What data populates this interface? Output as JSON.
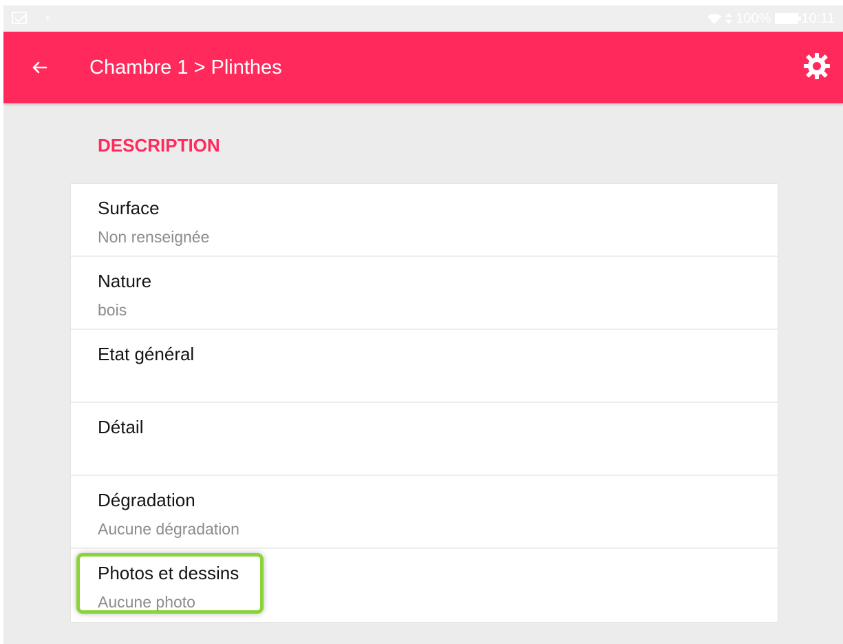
{
  "status_bar": {
    "battery": "100%",
    "time": "10:11"
  },
  "app_bar": {
    "title": "Chambre 1 > Plinthes"
  },
  "section": {
    "title": "DESCRIPTION"
  },
  "rows": [
    {
      "label": "Surface",
      "value": "Non renseignée"
    },
    {
      "label": "Nature",
      "value": "bois"
    },
    {
      "label": "Etat général",
      "value": ""
    },
    {
      "label": "Détail",
      "value": ""
    },
    {
      "label": "Dégradation",
      "value": "Aucune dégradation"
    },
    {
      "label": "Photos et dessins",
      "value": "Aucune photo"
    }
  ],
  "colors": {
    "accent": "#ff2a5b",
    "background": "#ececec",
    "card": "#ffffff",
    "highlight": "#8ad43a",
    "secondary_text": "#8c8c8c"
  },
  "icons": {
    "status_left": [
      "mail-icon",
      "balance-icon"
    ],
    "status_right": [
      "wifi-icon",
      "data-arrows-icon",
      "battery-icon"
    ],
    "app_bar": [
      "back-arrow-icon",
      "gear-icon"
    ]
  }
}
